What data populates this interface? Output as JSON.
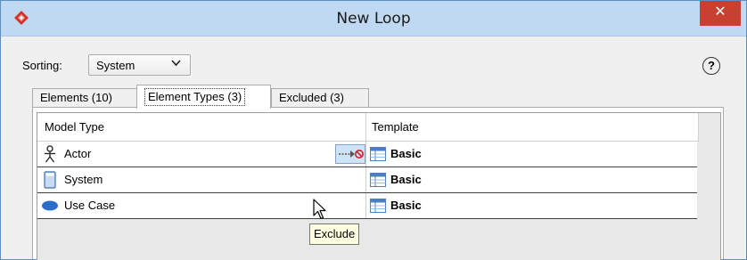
{
  "window": {
    "title": "New Loop",
    "close_glyph": "✕",
    "app_icon": "visual-paradigm-logo-icon"
  },
  "sorting": {
    "label": "Sorting:",
    "selected": "System",
    "chevron": "⌄"
  },
  "help": {
    "glyph": "?",
    "icon": "help-icon"
  },
  "tabs": [
    {
      "label": "Elements (10)",
      "active": false
    },
    {
      "label": "Element Types (3)",
      "active": true
    },
    {
      "label": "Excluded (3)",
      "active": false
    }
  ],
  "table": {
    "columns": [
      "Model Type",
      "Template"
    ],
    "rows": [
      {
        "model_type": "Actor",
        "template": "Basic",
        "icon": "actor-icon"
      },
      {
        "model_type": "System",
        "template": "Basic",
        "icon": "system-icon"
      },
      {
        "model_type": "Use Case",
        "template": "Basic",
        "icon": "use-case-icon"
      }
    ]
  },
  "tooltip": {
    "text": "Exclude"
  },
  "colors": {
    "titlebar": "#bfd9f3",
    "close": "#c84031",
    "use_case_blue": "#2a6cc9",
    "exclude_red": "#d2202f"
  }
}
